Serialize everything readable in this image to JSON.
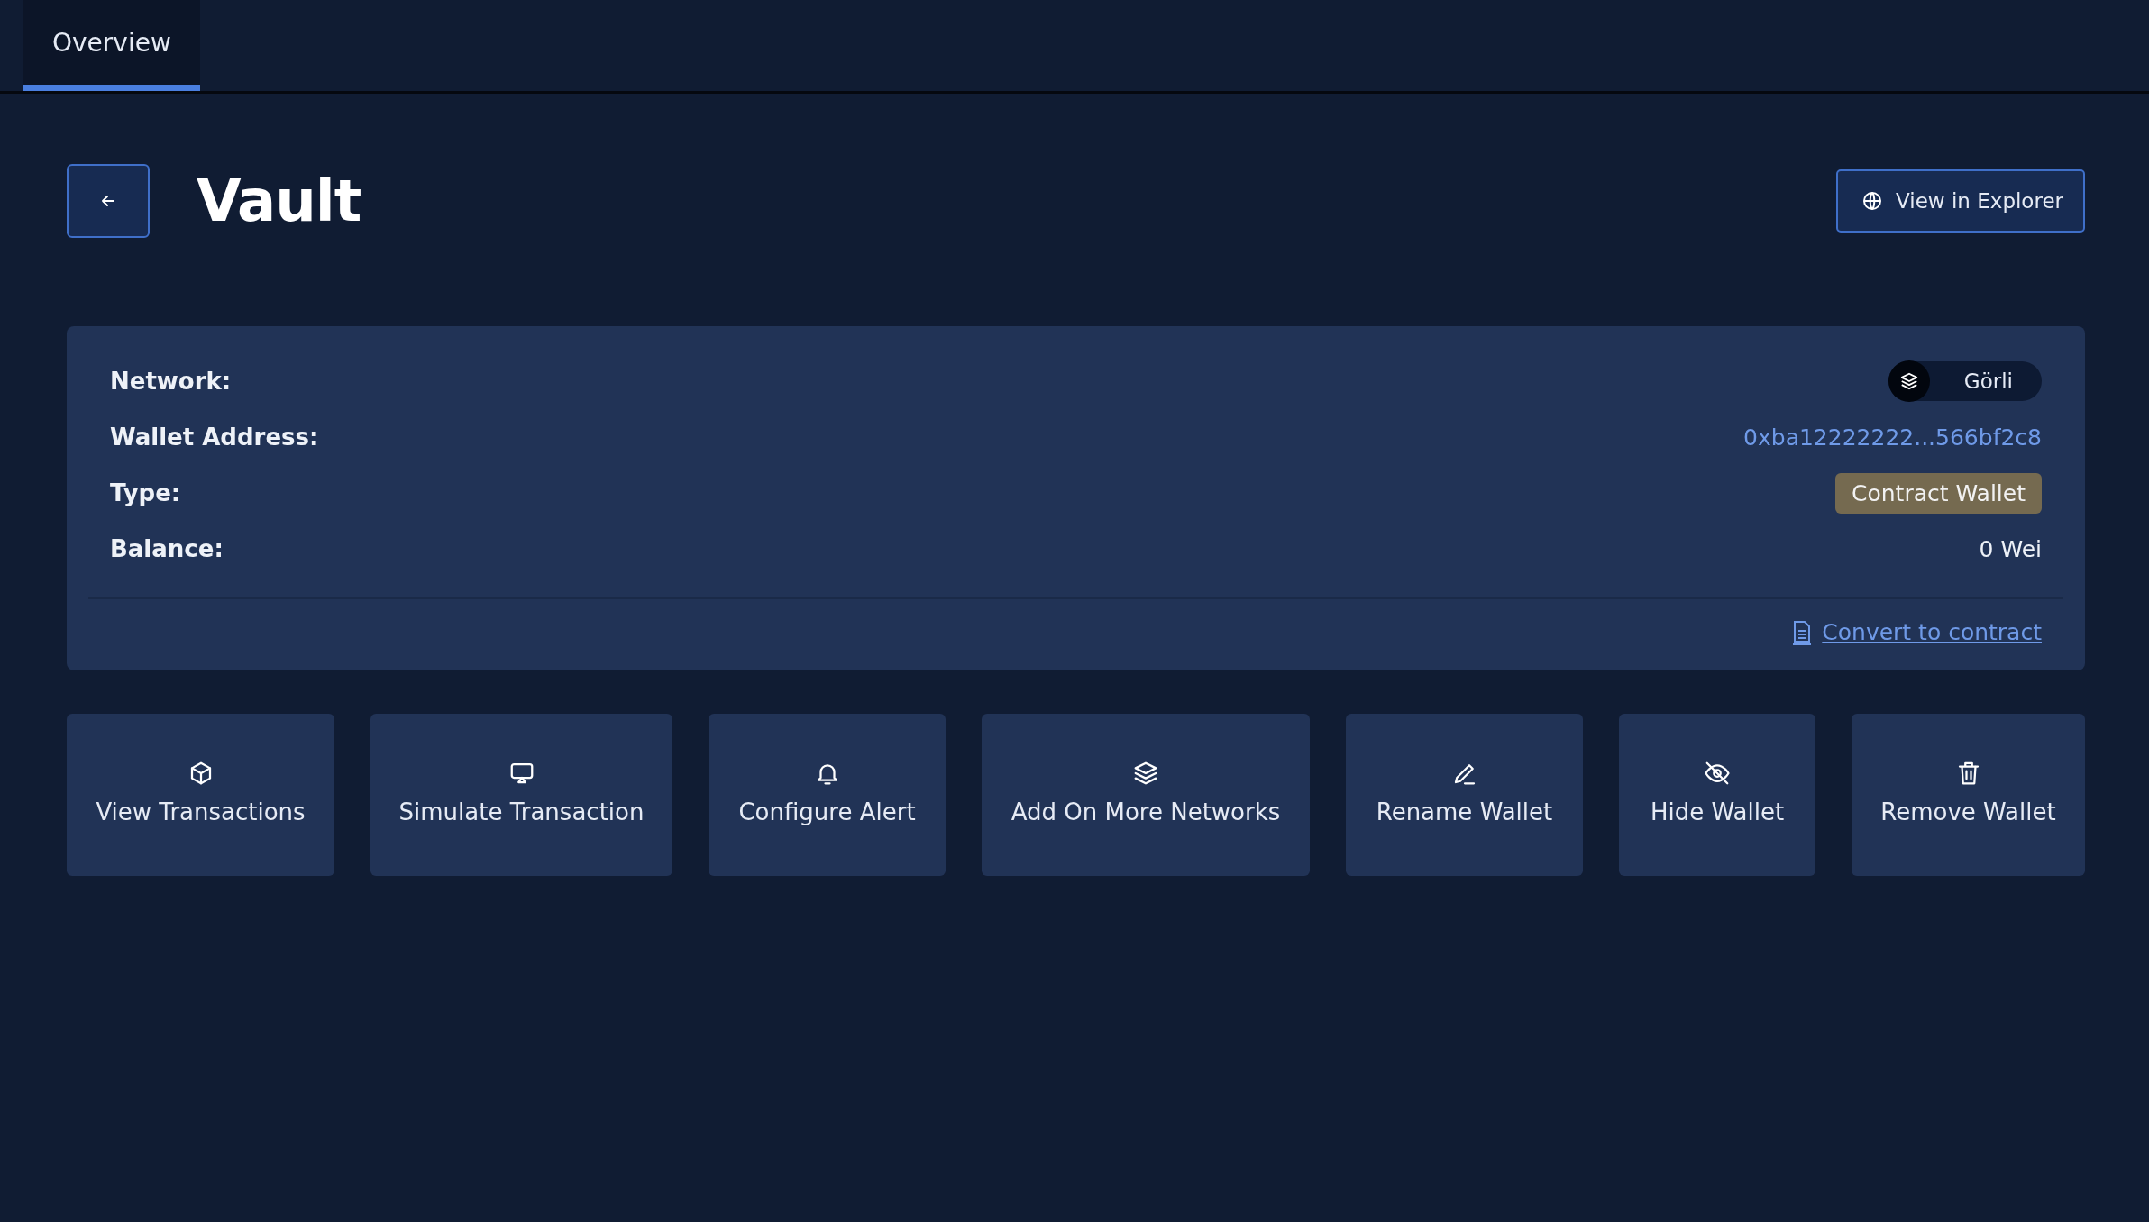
{
  "tabs": [
    {
      "label": "Overview",
      "selected": true
    }
  ],
  "header": {
    "title": "Vault",
    "explorer_button": "View in Explorer"
  },
  "details": [
    {
      "label": "Network:",
      "kind": "chip",
      "value": "Görli"
    },
    {
      "label": "Wallet Address:",
      "kind": "link",
      "value": "0xba12222222...566bf2c8"
    },
    {
      "label": "Type:",
      "kind": "badge",
      "value": "Contract Wallet"
    },
    {
      "label": "Balance:",
      "kind": "text",
      "value": "0 Wei"
    }
  ],
  "convert_link": "Convert to contract",
  "actions": [
    {
      "label": "View Transactions"
    },
    {
      "label": "Simulate Transaction"
    },
    {
      "label": "Configure Alert"
    },
    {
      "label": "Add On More Networks"
    },
    {
      "label": "Rename Wallet"
    },
    {
      "label": "Hide Wallet"
    },
    {
      "label": "Remove Wallet"
    }
  ]
}
